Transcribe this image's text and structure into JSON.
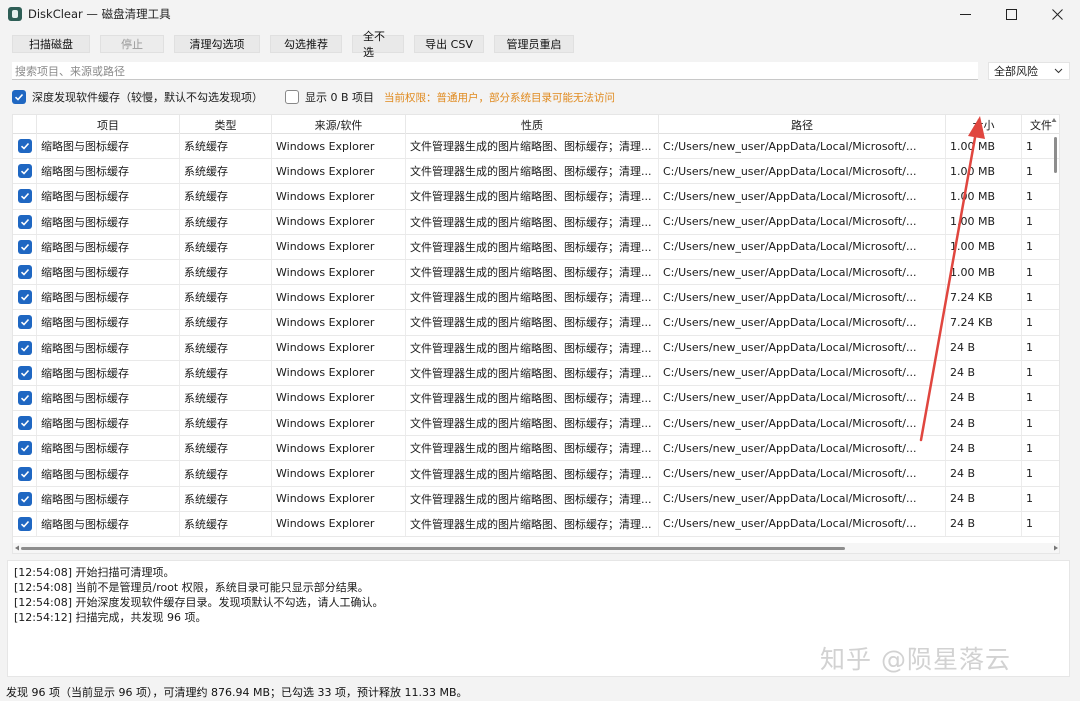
{
  "window": {
    "title": "DiskClear — 磁盘清理工具",
    "controls": [
      "minimize",
      "maximize",
      "close"
    ]
  },
  "toolbar": {
    "scan": "扫描磁盘",
    "stop": "停止",
    "clean_checked": "清理勾选项",
    "check_recommended": "勾选推荐",
    "uncheck_all": "全不选",
    "export_csv": "导出 CSV",
    "admin_restart": "管理员重启"
  },
  "search": {
    "placeholder": "搜索项目、来源或路径"
  },
  "risk_filter": {
    "selected": "全部风险"
  },
  "options": {
    "deep_discovery": "深度发现软件缓存（较慢，默认不勾选发现项）",
    "deep_discovery_checked": true,
    "show_zero": "显示 0 B 项目",
    "show_zero_checked": false,
    "permission_note": "当前权限：普通用户，部分系统目录可能无法访问"
  },
  "table": {
    "columns": [
      "项目",
      "类型",
      "来源/软件",
      "性质",
      "路径",
      "大小",
      "文件"
    ],
    "rows": [
      {
        "checked": true,
        "item": "缩略图与图标缓存",
        "type": "系统缓存",
        "source": "Windows Explorer",
        "nature": "文件管理器生成的图片缩略图、图标缓存；清理...",
        "path": "C:/Users/new_user/AppData/Local/Microsoft/...",
        "size": "1.00 MB",
        "files": "1"
      },
      {
        "checked": true,
        "item": "缩略图与图标缓存",
        "type": "系统缓存",
        "source": "Windows Explorer",
        "nature": "文件管理器生成的图片缩略图、图标缓存；清理...",
        "path": "C:/Users/new_user/AppData/Local/Microsoft/...",
        "size": "1.00 MB",
        "files": "1"
      },
      {
        "checked": true,
        "item": "缩略图与图标缓存",
        "type": "系统缓存",
        "source": "Windows Explorer",
        "nature": "文件管理器生成的图片缩略图、图标缓存；清理...",
        "path": "C:/Users/new_user/AppData/Local/Microsoft/...",
        "size": "1.00 MB",
        "files": "1"
      },
      {
        "checked": true,
        "item": "缩略图与图标缓存",
        "type": "系统缓存",
        "source": "Windows Explorer",
        "nature": "文件管理器生成的图片缩略图、图标缓存；清理...",
        "path": "C:/Users/new_user/AppData/Local/Microsoft/...",
        "size": "1.00 MB",
        "files": "1"
      },
      {
        "checked": true,
        "item": "缩略图与图标缓存",
        "type": "系统缓存",
        "source": "Windows Explorer",
        "nature": "文件管理器生成的图片缩略图、图标缓存；清理...",
        "path": "C:/Users/new_user/AppData/Local/Microsoft/...",
        "size": "1.00 MB",
        "files": "1"
      },
      {
        "checked": true,
        "item": "缩略图与图标缓存",
        "type": "系统缓存",
        "source": "Windows Explorer",
        "nature": "文件管理器生成的图片缩略图、图标缓存；清理...",
        "path": "C:/Users/new_user/AppData/Local/Microsoft/...",
        "size": "1.00 MB",
        "files": "1"
      },
      {
        "checked": true,
        "item": "缩略图与图标缓存",
        "type": "系统缓存",
        "source": "Windows Explorer",
        "nature": "文件管理器生成的图片缩略图、图标缓存；清理...",
        "path": "C:/Users/new_user/AppData/Local/Microsoft/...",
        "size": "7.24 KB",
        "files": "1"
      },
      {
        "checked": true,
        "item": "缩略图与图标缓存",
        "type": "系统缓存",
        "source": "Windows Explorer",
        "nature": "文件管理器生成的图片缩略图、图标缓存；清理...",
        "path": "C:/Users/new_user/AppData/Local/Microsoft/...",
        "size": "7.24 KB",
        "files": "1"
      },
      {
        "checked": true,
        "item": "缩略图与图标缓存",
        "type": "系统缓存",
        "source": "Windows Explorer",
        "nature": "文件管理器生成的图片缩略图、图标缓存；清理...",
        "path": "C:/Users/new_user/AppData/Local/Microsoft/...",
        "size": "24 B",
        "files": "1"
      },
      {
        "checked": true,
        "item": "缩略图与图标缓存",
        "type": "系统缓存",
        "source": "Windows Explorer",
        "nature": "文件管理器生成的图片缩略图、图标缓存；清理...",
        "path": "C:/Users/new_user/AppData/Local/Microsoft/...",
        "size": "24 B",
        "files": "1"
      },
      {
        "checked": true,
        "item": "缩略图与图标缓存",
        "type": "系统缓存",
        "source": "Windows Explorer",
        "nature": "文件管理器生成的图片缩略图、图标缓存；清理...",
        "path": "C:/Users/new_user/AppData/Local/Microsoft/...",
        "size": "24 B",
        "files": "1"
      },
      {
        "checked": true,
        "item": "缩略图与图标缓存",
        "type": "系统缓存",
        "source": "Windows Explorer",
        "nature": "文件管理器生成的图片缩略图、图标缓存；清理...",
        "path": "C:/Users/new_user/AppData/Local/Microsoft/...",
        "size": "24 B",
        "files": "1"
      },
      {
        "checked": true,
        "item": "缩略图与图标缓存",
        "type": "系统缓存",
        "source": "Windows Explorer",
        "nature": "文件管理器生成的图片缩略图、图标缓存；清理...",
        "path": "C:/Users/new_user/AppData/Local/Microsoft/...",
        "size": "24 B",
        "files": "1"
      },
      {
        "checked": true,
        "item": "缩略图与图标缓存",
        "type": "系统缓存",
        "source": "Windows Explorer",
        "nature": "文件管理器生成的图片缩略图、图标缓存；清理...",
        "path": "C:/Users/new_user/AppData/Local/Microsoft/...",
        "size": "24 B",
        "files": "1"
      },
      {
        "checked": true,
        "item": "缩略图与图标缓存",
        "type": "系统缓存",
        "source": "Windows Explorer",
        "nature": "文件管理器生成的图片缩略图、图标缓存；清理...",
        "path": "C:/Users/new_user/AppData/Local/Microsoft/...",
        "size": "24 B",
        "files": "1"
      },
      {
        "checked": true,
        "item": "缩略图与图标缓存",
        "type": "系统缓存",
        "source": "Windows Explorer",
        "nature": "文件管理器生成的图片缩略图、图标缓存；清理...",
        "path": "C:/Users/new_user/AppData/Local/Microsoft/...",
        "size": "24 B",
        "files": "1"
      }
    ]
  },
  "log": {
    "lines": [
      "[12:54:08] 开始扫描可清理项。",
      "[12:54:08] 当前不是管理员/root 权限，系统目录可能只显示部分结果。",
      "[12:54:08] 开始深度发现软件缓存目录。发现项默认不勾选，请人工确认。",
      "[12:54:12] 扫描完成，共发现 96 项。"
    ]
  },
  "watermark": "知乎 @陨星落云",
  "status": "发现 96 项（当前显示 96 项），可清理约 876.94 MB；已勾选 33 项，预计释放 11.33 MB。",
  "colors": {
    "accent": "#1f67c2",
    "warning": "#e08a1e",
    "arrow": "#e0463f"
  }
}
